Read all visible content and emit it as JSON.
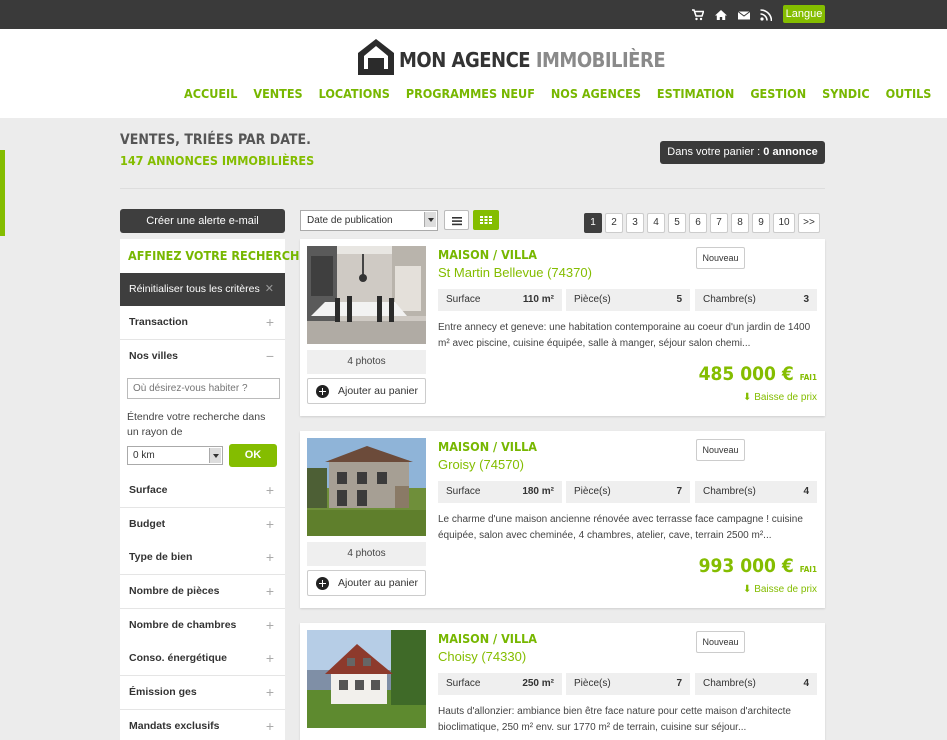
{
  "topbar": {
    "icons": [
      "cart-icon",
      "home-icon",
      "mail-icon",
      "rss-icon"
    ],
    "lang_label": "Langue"
  },
  "header": {
    "logo_main": "MON AGENCE ",
    "logo_light": "IMMOBILIÈRE",
    "nav": [
      "ACCUEIL",
      "VENTES",
      "LOCATIONS",
      "PROGRAMMES NEUF",
      "NOS AGENCES",
      "ESTIMATION",
      "GESTION",
      "SYNDIC",
      "OUTILS"
    ]
  },
  "listing_header": {
    "title": "VENTES, TRIÉES PAR DATE.",
    "count": "147 ANNONCES IMMOBILIÈRES",
    "cart_prefix": "Dans votre panier : ",
    "cart_value": "0 annonce"
  },
  "sidebar": {
    "alert_button": "Créer une alerte e-mail",
    "heading": "AFFINEZ VOTRE RECHERCHE",
    "reset_label": "Réinitialiser tous les critères",
    "criteria": [
      "Transaction",
      "Nos villes",
      "Surface",
      "Budget",
      "Type de bien",
      "Nombre de pièces",
      "Nombre de chambres",
      "Conso. énergétique",
      "Émission ges",
      "Mandats exclusifs"
    ],
    "ville_placeholder": "Où désirez-vous habiter ?",
    "etendre_text": "Étendre votre recherche dans un rayon de",
    "radius_value": "0 km",
    "ok_label": "OK"
  },
  "toolbar": {
    "sort_value": "Date de publication",
    "pages": [
      "1",
      "2",
      "3",
      "4",
      "5",
      "6",
      "7",
      "8",
      "9",
      "10",
      ">>"
    ],
    "current_page": "1"
  },
  "listings": [
    {
      "type": "MAISON / VILLA",
      "location": "St Martin Bellevue (74370)",
      "badge": "Nouveau",
      "photos": "4 photos",
      "add_cart": "Ajouter au panier",
      "surface_label": "Surface",
      "surface": "110 m²",
      "pieces_label": "Pièce(s)",
      "pieces": "5",
      "chambres_label": "Chambre(s)",
      "chambres": "3",
      "description": "Entre annecy et geneve: une habitation contemporaine au coeur d'un jardin de 1400 m² avec piscine, cuisine équipée, salle à manger, séjour salon chemi...",
      "price": "485 000 €",
      "price_suffix": "FAI",
      "price_note": "1",
      "drop": "Baisse de prix"
    },
    {
      "type": "MAISON / VILLA",
      "location": "Groisy (74570)",
      "badge": "Nouveau",
      "photos": "4 photos",
      "add_cart": "Ajouter au panier",
      "surface_label": "Surface",
      "surface": "180 m²",
      "pieces_label": "Pièce(s)",
      "pieces": "7",
      "chambres_label": "Chambre(s)",
      "chambres": "4",
      "description": "Le charme d'une maison ancienne rénovée avec terrasse face campagne ! cuisine équipée, salon avec cheminée, 4 chambres, atelier, cave, terrain 2500 m²...",
      "price": "993 000 €",
      "price_suffix": "FAI",
      "price_note": "1",
      "drop": "Baisse de prix"
    },
    {
      "type": "MAISON / VILLA",
      "location": "Choisy (74330)",
      "badge": "Nouveau",
      "photos": "",
      "add_cart": "",
      "surface_label": "Surface",
      "surface": "250 m²",
      "pieces_label": "Pièce(s)",
      "pieces": "7",
      "chambres_label": "Chambre(s)",
      "chambres": "4",
      "description": "Hauts d'allonzier: ambiance bien être face nature pour cette maison d'architecte bioclimatique, 250 m² env. sur 1770 m² de terrain, cuisine sur séjour...",
      "price": "",
      "price_suffix": "",
      "price_note": "",
      "drop": ""
    }
  ],
  "colors": {
    "accent": "#84bd00",
    "dark": "#3a3a3a",
    "background": "#ececec"
  }
}
